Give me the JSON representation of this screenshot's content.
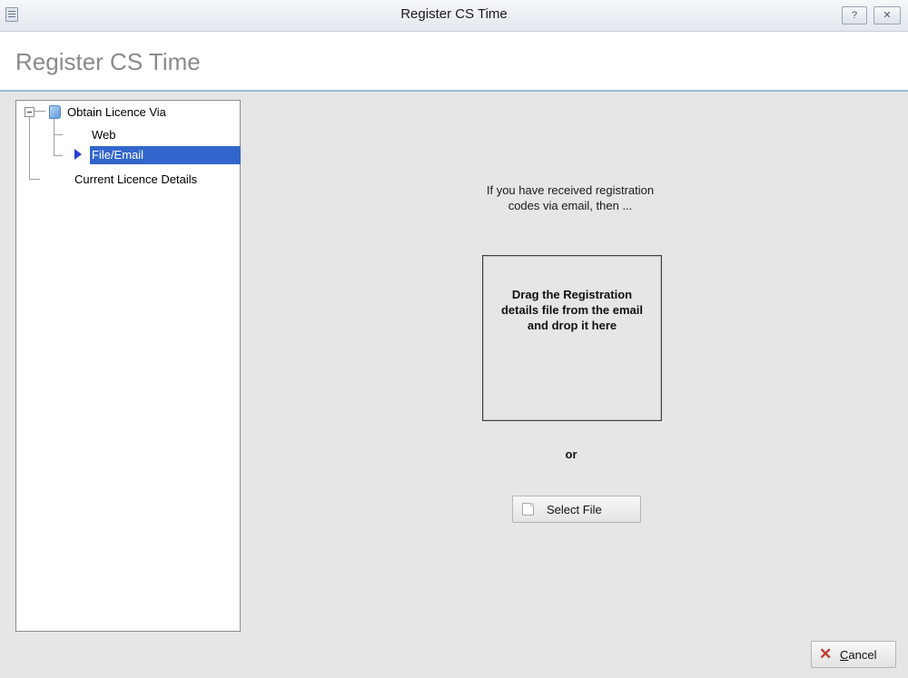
{
  "window": {
    "title": "Register CS Time",
    "help_label": "?",
    "close_label": "✕"
  },
  "header": {
    "title": "Register CS Time"
  },
  "tree": {
    "root": {
      "label": "Obtain Licence Via",
      "expanded": true
    },
    "children": [
      {
        "label": "Web",
        "selected": false
      },
      {
        "label": "File/Email",
        "selected": true
      }
    ],
    "sibling": {
      "label": "Current Licence Details"
    }
  },
  "main": {
    "intro": "If you have received registration codes via email, then ...",
    "dropzone_text": "Drag the Registration details file from the email and drop it here",
    "or_label": "or",
    "select_file_label": "Select File"
  },
  "footer": {
    "cancel_label": "Cancel",
    "cancel_accelerator": "C",
    "cancel_rest": "ancel"
  },
  "colors": {
    "selection": "#3366cc",
    "header_border": "#9fb6d6",
    "background": "#e6e6e6",
    "cancel_icon": "#c0392b"
  }
}
